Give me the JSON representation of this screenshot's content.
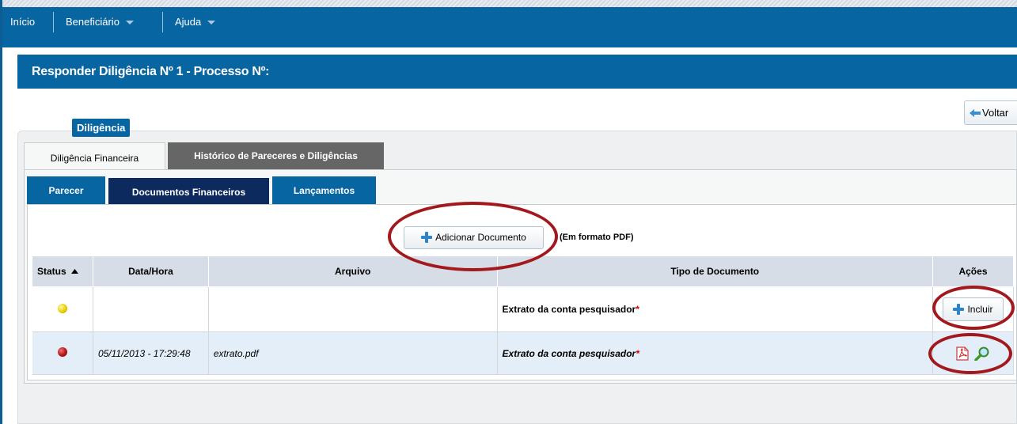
{
  "nav": {
    "inicio": "Início",
    "beneficiario": "Beneficiário",
    "ajuda": "Ajuda"
  },
  "page": {
    "title": "Responder Diligência Nº 1 - Processo Nº:",
    "voltar": "Voltar",
    "diligencia_label": "Diligência"
  },
  "tabs": {
    "financeira": "Diligência Financeira",
    "historico": "Histórico de Pareceres e Diligências"
  },
  "subtabs": {
    "parecer": "Parecer",
    "documentos": "Documentos Financeiros",
    "lancamentos": "Lançamentos"
  },
  "actions": {
    "add_document": "Adicionar Documento",
    "pdf_note": "(Em formato PDF)"
  },
  "table": {
    "headers": {
      "status": "Status",
      "datahora": "Data/Hora",
      "arquivo": "Arquivo",
      "tipo": "Tipo de Documento",
      "acoes": "Ações"
    },
    "rows": [
      {
        "status": "yellow",
        "datahora": "",
        "arquivo": "",
        "tipo": "Extrato da conta pesquisador",
        "required": "*",
        "acao": "Incluir"
      },
      {
        "status": "red",
        "datahora": "05/11/2013 - 17:29:48",
        "arquivo": "extrato.pdf",
        "tipo": "Extrato da conta pesquisador",
        "required": "*"
      }
    ]
  },
  "colors": {
    "nav_blue": "#0765a1",
    "dark_tab": "#0d2a5e",
    "highlight_ring": "#a3181d"
  }
}
